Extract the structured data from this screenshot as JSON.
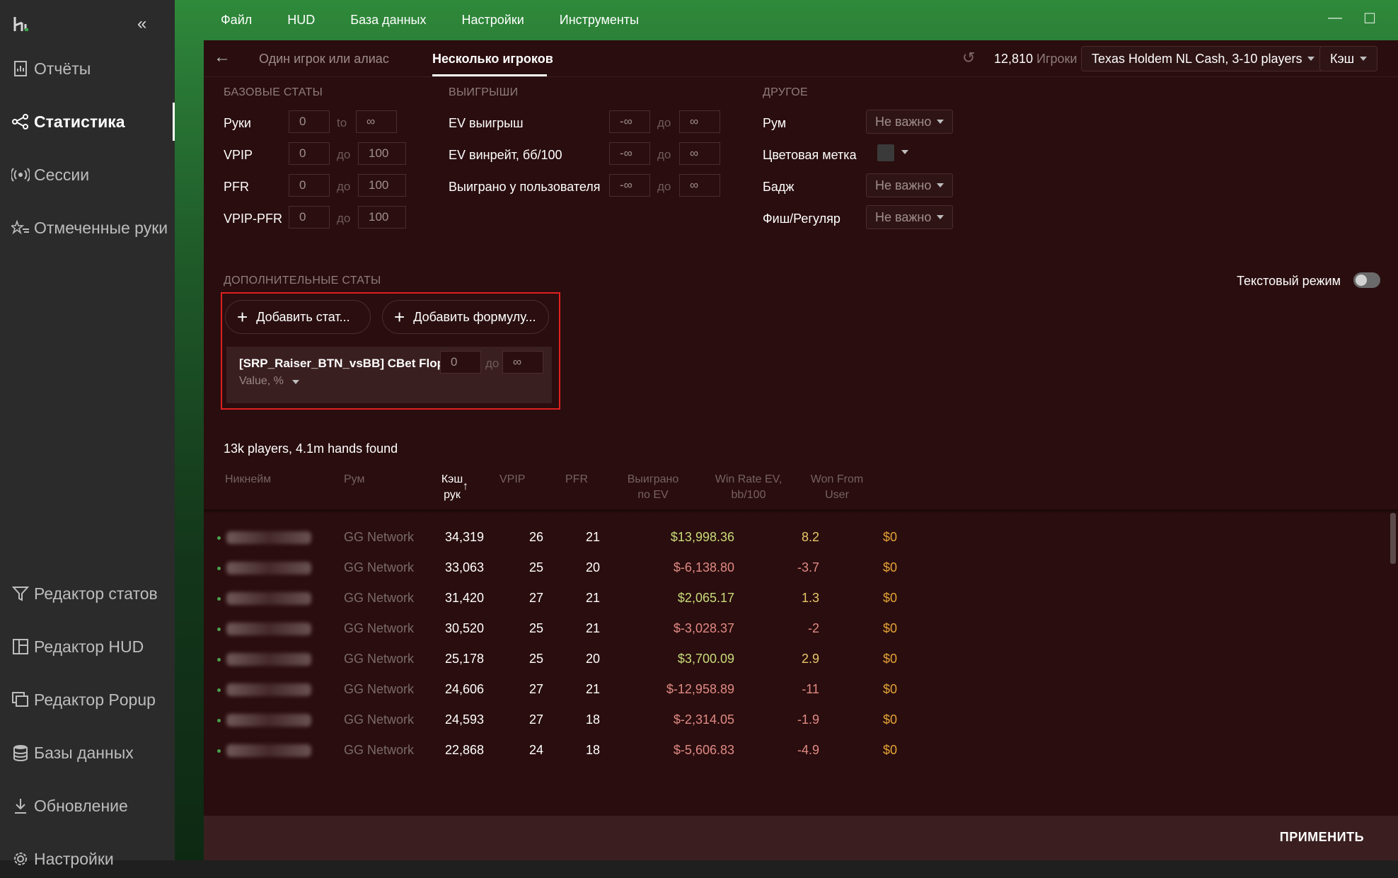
{
  "sidebar": {
    "items": [
      {
        "label": "Отчёты",
        "icon": "report-icon"
      },
      {
        "label": "Статистика",
        "icon": "share-nodes-icon",
        "active": true
      },
      {
        "label": "Сессии",
        "icon": "broadcast-icon"
      },
      {
        "label": "Отмеченные руки",
        "icon": "star-list-icon"
      },
      {
        "label": "Редактор статов",
        "icon": "filter-icon"
      },
      {
        "label": "Редактор HUD",
        "icon": "layout-icon"
      },
      {
        "label": "Редактор Popup",
        "icon": "windows-icon"
      },
      {
        "label": "Базы данных",
        "icon": "database-icon"
      },
      {
        "label": "Обновление",
        "icon": "download-icon"
      },
      {
        "label": "Настройки",
        "icon": "gear-icon"
      }
    ]
  },
  "menu": [
    "Файл",
    "HUD",
    "База данных",
    "Настройки",
    "Инструменты"
  ],
  "tabs": {
    "single": "Один игрок или алиас",
    "multi": "Несколько игроков"
  },
  "header": {
    "players_count": "12,810",
    "players_label": "Игроки",
    "game": "Texas Holdem NL Cash, 3-10 players",
    "mode": "Кэш"
  },
  "base_stats": {
    "title": "БАЗОВЫЕ СТАТЫ",
    "rows": [
      {
        "label": "Руки",
        "min": "0",
        "conn": "to",
        "max": "∞"
      },
      {
        "label": "VPIP",
        "min": "0",
        "conn": "до",
        "max": "100"
      },
      {
        "label": "PFR",
        "min": "0",
        "conn": "до",
        "max": "100"
      },
      {
        "label": "VPIP-PFR",
        "min": "0",
        "conn": "до",
        "max": "100"
      }
    ]
  },
  "winnings": {
    "title": "ВЫИГРЫШИ",
    "rows": [
      {
        "label": "EV выигрыш",
        "min": "-∞",
        "conn": "до",
        "max": "∞"
      },
      {
        "label": "EV винрейт, бб/100",
        "min": "-∞",
        "conn": "до",
        "max": "∞"
      },
      {
        "label": "Выиграно у пользователя",
        "min": "-∞",
        "conn": "до",
        "max": "∞"
      }
    ]
  },
  "other": {
    "title": "ДРУГОЕ",
    "rows": [
      {
        "label": "Рум",
        "value": "Не важно"
      },
      {
        "label": "Цветовая метка",
        "value": ""
      },
      {
        "label": "Бадж",
        "value": "Не важно"
      },
      {
        "label": "Фиш/Регуляр",
        "value": "Не важно"
      }
    ]
  },
  "additional": {
    "title": "ДОПОЛНИТЕЛЬНЫЕ СТАТЫ",
    "text_mode": "Текстовый режим",
    "add_stat": "Добавить стат...",
    "add_formula": "Добавить формулу...",
    "stat": {
      "name": "[SRP_Raiser_BTN_vsBB] CBet Flop",
      "type": "Value, %",
      "min": "0",
      "conn": "до",
      "max": "∞"
    }
  },
  "results": {
    "found": "13k players, 4.1m hands found",
    "columns": {
      "nick": "Никнейм",
      "room": "Рум",
      "hands": "Кэш рук",
      "vpip": "VPIP",
      "pfr": "PFR",
      "ev": "Выиграно по EV",
      "wr": "Win Rate EV, bb/100",
      "won": "Won From User",
      "sort_arrow": "↑"
    },
    "rows": [
      {
        "room": "GG Network",
        "hands": "34,319",
        "vpip": "26",
        "pfr": "21",
        "ev": "$13,998.36",
        "wr": "8.2",
        "won": "$0",
        "ev_sign": "pos",
        "wr_sign": "pos"
      },
      {
        "room": "GG Network",
        "hands": "33,063",
        "vpip": "25",
        "pfr": "20",
        "ev": "$-6,138.80",
        "wr": "-3.7",
        "won": "$0",
        "ev_sign": "neg",
        "wr_sign": "neg"
      },
      {
        "room": "GG Network",
        "hands": "31,420",
        "vpip": "27",
        "pfr": "21",
        "ev": "$2,065.17",
        "wr": "1.3",
        "won": "$0",
        "ev_sign": "pos",
        "wr_sign": "pos"
      },
      {
        "room": "GG Network",
        "hands": "30,520",
        "vpip": "25",
        "pfr": "21",
        "ev": "$-3,028.37",
        "wr": "-2",
        "won": "$0",
        "ev_sign": "neg",
        "wr_sign": "neg"
      },
      {
        "room": "GG Network",
        "hands": "25,178",
        "vpip": "25",
        "pfr": "20",
        "ev": "$3,700.09",
        "wr": "2.9",
        "won": "$0",
        "ev_sign": "pos",
        "wr_sign": "pos"
      },
      {
        "room": "GG Network",
        "hands": "24,606",
        "vpip": "27",
        "pfr": "21",
        "ev": "$-12,958.89",
        "wr": "-11",
        "won": "$0",
        "ev_sign": "neg",
        "wr_sign": "neg"
      },
      {
        "room": "GG Network",
        "hands": "24,593",
        "vpip": "27",
        "pfr": "18",
        "ev": "$-2,314.05",
        "wr": "-1.9",
        "won": "$0",
        "ev_sign": "neg",
        "wr_sign": "neg"
      },
      {
        "room": "GG Network",
        "hands": "22,868",
        "vpip": "24",
        "pfr": "18",
        "ev": "$-5,606.83",
        "wr": "-4.9",
        "won": "$0",
        "ev_sign": "neg",
        "wr_sign": "neg"
      }
    ]
  },
  "footer": {
    "apply": "ПРИМЕНИТЬ"
  },
  "colors": {
    "accent_green": "#2f8a3a",
    "panel": "#2a0d0e",
    "highlight": "#e02020",
    "positive": "#c7dd7a",
    "negative": "#e08a84",
    "won": "#e4a436"
  }
}
